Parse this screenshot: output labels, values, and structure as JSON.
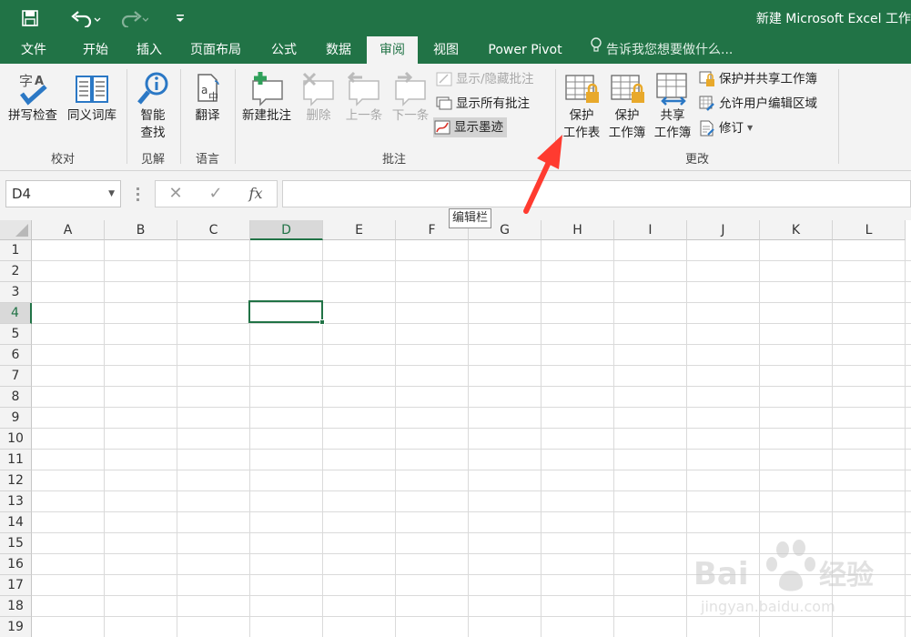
{
  "titlebar": {
    "title": "新建 Microsoft Excel 工作",
    "icons": [
      "save-icon",
      "undo-icon",
      "redo-icon",
      "customize-toolbar-icon"
    ]
  },
  "tabs": [
    {
      "label": "文件",
      "active": false
    },
    {
      "label": "开始",
      "active": false
    },
    {
      "label": "插入",
      "active": false
    },
    {
      "label": "页面布局",
      "active": false
    },
    {
      "label": "公式",
      "active": false
    },
    {
      "label": "数据",
      "active": false
    },
    {
      "label": "审阅",
      "active": true
    },
    {
      "label": "视图",
      "active": false
    },
    {
      "label": "Power Pivot",
      "active": false
    }
  ],
  "tell_me": "告诉我您想要做什么...",
  "ribbon": {
    "groups": {
      "proofing": "校对",
      "insights": "见解",
      "language": "语言",
      "comments": "批注",
      "changes": "更改"
    },
    "spelling": "拼写检查",
    "thesaurus": "同义词库",
    "smart_lookup_1": "智能",
    "smart_lookup_2": "查找",
    "translate": "翻译",
    "new_comment": "新建批注",
    "delete": "删除",
    "previous": "上一条",
    "next": "下一条",
    "show_hide_comment": "显示/隐藏批注",
    "show_all_comments": "显示所有批注",
    "show_ink": "显示墨迹",
    "protect_sheet_1": "保护",
    "protect_sheet_2": "工作表",
    "protect_workbook_1": "保护",
    "protect_workbook_2": "工作簿",
    "share_workbook_1": "共享",
    "share_workbook_2": "工作簿",
    "protect_share": "保护并共享工作簿",
    "allow_edit_ranges": "允许用户编辑区域",
    "track_changes": "修订"
  },
  "formula_bar": {
    "name_box": "D4",
    "formula": "",
    "tooltip": "编辑栏"
  },
  "sheet": {
    "columns": [
      "A",
      "B",
      "C",
      "D",
      "E",
      "F",
      "G",
      "H",
      "I",
      "J",
      "K",
      "L"
    ],
    "rows": [
      "1",
      "2",
      "3",
      "4",
      "5",
      "6",
      "7",
      "8",
      "9",
      "10",
      "11",
      "12",
      "13",
      "14",
      "15",
      "16",
      "17",
      "18",
      "19"
    ],
    "selected_col": "D",
    "selected_row": "4"
  },
  "colors": {
    "accent": "#217346",
    "arrow": "#ff3b30"
  }
}
